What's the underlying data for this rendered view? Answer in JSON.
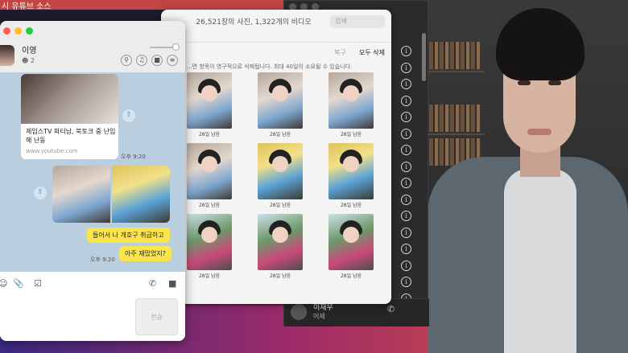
{
  "colors": {
    "chat_bg": "#b9cfe0",
    "bubble_yellow": "#fbe54d",
    "dark_window": "#2b2b2d",
    "traffic_red": "#ff5f57",
    "traffic_yellow": "#febc2e",
    "traffic_green": "#28c840"
  },
  "top_bar": {
    "text": "시 유튜브 소스"
  },
  "photos": {
    "title": "26,521장의 사진, 1,322개의 비디오",
    "search_placeholder": "검색",
    "recover_label": "복구",
    "delete_all_label": "모두 삭제",
    "notice": "...면 항목이 영구적으로 삭제됩니다. 최대 40일이 소요될 수 있습니다.",
    "thumb_label": "28일 남음",
    "thumbs": [
      {
        "style": "selfie"
      },
      {
        "style": "selfie"
      },
      {
        "style": "selfie"
      },
      {
        "style": "selfie"
      },
      {
        "style": "yellow"
      },
      {
        "style": "yellow"
      },
      {
        "style": "street"
      },
      {
        "style": "street"
      },
      {
        "style": "street"
      }
    ]
  },
  "chat": {
    "name": "이영",
    "member_count": "2",
    "link_title": "제임스TV 파티남, 북토크 중 난입해 난동",
    "link_url": "www.youtube.com",
    "time_1": "오후 9:20",
    "bubble_1": "들어서 나 개호구 취급하고",
    "bubble_2": "아주 재밌었지?",
    "time_2": "오후 9:20",
    "send_label": "전송"
  },
  "contacts": {
    "bottom_name": "이재우",
    "bottom_sub": "어제",
    "info_rows": 16
  }
}
